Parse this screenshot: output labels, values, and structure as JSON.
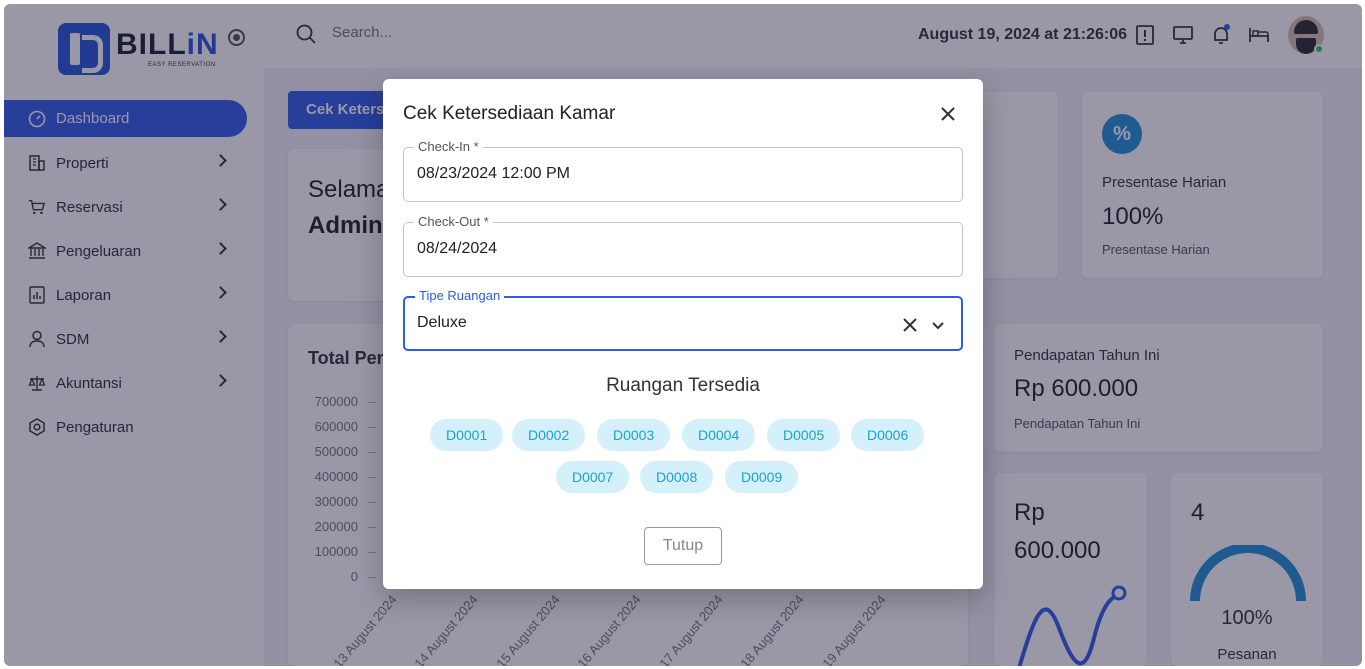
{
  "brand": {
    "name_main": "BILL",
    "name_accent": "iN",
    "tagline": "EASY RESERVATION"
  },
  "sidebar": {
    "items": [
      {
        "label": "Dashboard",
        "icon": "gauge-icon",
        "active": true,
        "has_submenu": false
      },
      {
        "label": "Properti",
        "icon": "building-icon",
        "active": false,
        "has_submenu": true
      },
      {
        "label": "Reservasi",
        "icon": "cart-icon",
        "active": false,
        "has_submenu": true
      },
      {
        "label": "Pengeluaran",
        "icon": "bank-icon",
        "active": false,
        "has_submenu": true
      },
      {
        "label": "Laporan",
        "icon": "report-icon",
        "active": false,
        "has_submenu": true
      },
      {
        "label": "SDM",
        "icon": "user-icon",
        "active": false,
        "has_submenu": true
      },
      {
        "label": "Akuntansi",
        "icon": "scale-icon",
        "active": false,
        "has_submenu": true
      },
      {
        "label": "Pengaturan",
        "icon": "settings-hex-icon",
        "active": false,
        "has_submenu": false
      }
    ]
  },
  "topbar": {
    "search_placeholder": "Search...",
    "datetime": "August 19, 2024 at 21:26:06",
    "icons": [
      "alert-icon",
      "monitor-icon",
      "bell-icon",
      "bed-icon"
    ]
  },
  "main": {
    "cek_button_label": "Cek Ketersediaan Kamar",
    "welcome_line1": "Selamat Datang,",
    "welcome_line2": "Admin",
    "presentase": {
      "title": "Presentase Harian",
      "value": "100%",
      "subtitle": "Presentase Harian",
      "icon": "%"
    },
    "pendapatan": {
      "title": "Pendapatan Tahun Ini",
      "value": "Rp 600.000",
      "subtitle": "Pendapatan Tahun Ini"
    },
    "small_card_1": {
      "value_line1": "Rp",
      "value_line2": "600.000"
    },
    "small_card_2": {
      "value": "4",
      "gauge_label": "100%",
      "label": "Pesanan",
      "gauge_fraction": 1.0
    }
  },
  "chart_data": {
    "type": "line",
    "title": "Total Pendapatan",
    "yticks": [
      "700000",
      "600000",
      "500000",
      "400000",
      "300000",
      "200000",
      "100000",
      "0"
    ],
    "categories": [
      "13 August 2024",
      "14 August 2024",
      "15 August 2024",
      "16 August 2024",
      "17 August 2024",
      "18 August 2024",
      "19 August 2024"
    ],
    "ylim": [
      0,
      700000
    ]
  },
  "modal": {
    "title": "Cek Ketersediaan Kamar",
    "checkin": {
      "label": "Check-In *",
      "value": "08/23/2024 12:00 PM"
    },
    "checkout": {
      "label": "Check-Out *",
      "value": "08/24/2024"
    },
    "tipe": {
      "label": "Tipe Ruangan",
      "value": "Deluxe"
    },
    "rooms_heading": "Ruangan Tersedia",
    "rooms": [
      "D0001",
      "D0002",
      "D0003",
      "D0004",
      "D0005",
      "D0006",
      "D0007",
      "D0008",
      "D0009"
    ],
    "close_button": "Tutup"
  },
  "colors": {
    "primary": "#2e5be8",
    "chip_bg": "#d4f0fb",
    "chip_text": "#1e9fd4",
    "overlay": "rgba(30,26,60,0.45)"
  }
}
